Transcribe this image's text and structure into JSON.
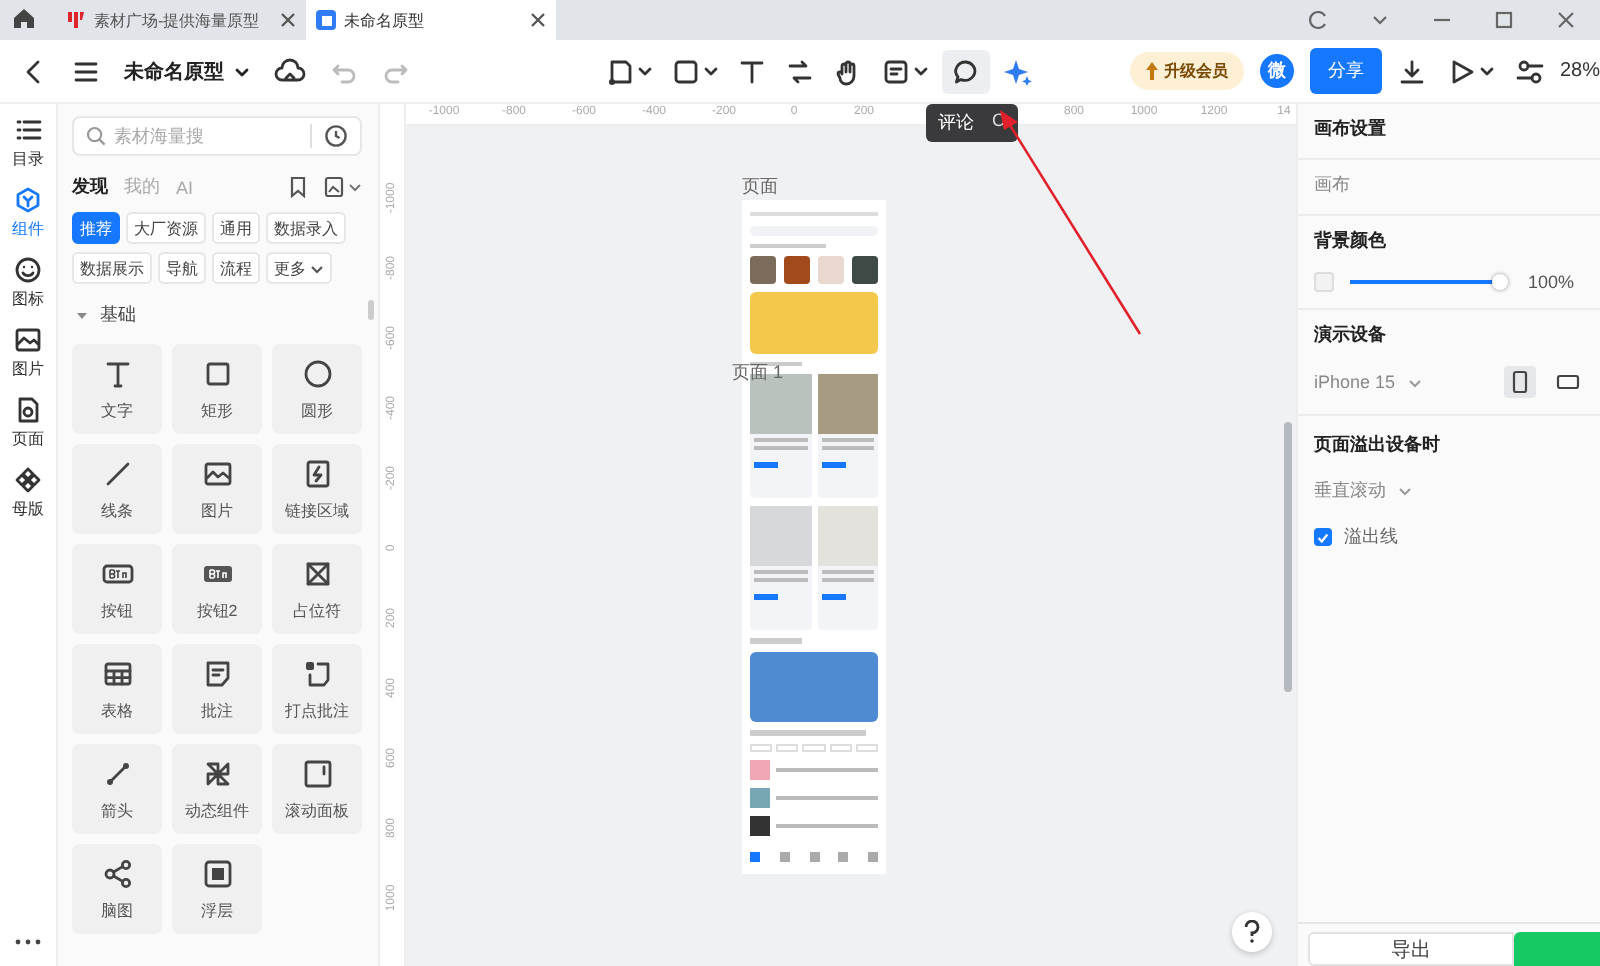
{
  "browser_tabs": [
    {
      "title": "素材广场-提供海量原型",
      "selected": false
    },
    {
      "title": "未命名原型",
      "selected": true
    }
  ],
  "toolbar": {
    "title": "未命名原型",
    "upgrade": "升级会员",
    "avatar": "微",
    "share": "分享",
    "zoom": "28%"
  },
  "tooltip": {
    "label": "评论",
    "shortcut": "C"
  },
  "rail": [
    {
      "label": "目录",
      "kind": "list",
      "selected": false
    },
    {
      "label": "组件",
      "kind": "component",
      "selected": true
    },
    {
      "label": "图标",
      "kind": "smile",
      "selected": false
    },
    {
      "label": "图片",
      "kind": "image",
      "selected": false
    },
    {
      "label": "页面",
      "kind": "page",
      "selected": false
    },
    {
      "label": "母版",
      "kind": "master",
      "selected": false
    }
  ],
  "panel": {
    "search": {
      "placeholder": "素材海量搜"
    },
    "tabs": [
      {
        "label": "发现",
        "selected": true
      },
      {
        "label": "我的",
        "selected": false
      },
      {
        "label": "AI",
        "selected": false
      }
    ],
    "chips": [
      {
        "label": "推荐",
        "selected": true
      },
      {
        "label": "大厂资源",
        "selected": false
      },
      {
        "label": "通用",
        "selected": false
      },
      {
        "label": "数据录入",
        "selected": false
      },
      {
        "label": "数据展示",
        "selected": false
      },
      {
        "label": "导航",
        "selected": false
      },
      {
        "label": "流程",
        "selected": false
      },
      {
        "label": "更多",
        "selected": false,
        "kind": "dropdown"
      }
    ],
    "section": {
      "title": "基础",
      "expanded": true
    },
    "components": [
      {
        "label": "文字",
        "kind": "text"
      },
      {
        "label": "矩形",
        "kind": "rect"
      },
      {
        "label": "圆形",
        "kind": "circle"
      },
      {
        "label": "线条",
        "kind": "line"
      },
      {
        "label": "图片",
        "kind": "image"
      },
      {
        "label": "链接区域",
        "kind": "link"
      },
      {
        "label": "按钮",
        "kind": "button"
      },
      {
        "label": "按钮2",
        "kind": "button2"
      },
      {
        "label": "占位符",
        "kind": "placeholder"
      },
      {
        "label": "表格",
        "kind": "table"
      },
      {
        "label": "批注",
        "kind": "note"
      },
      {
        "label": "打点批注",
        "kind": "pin"
      },
      {
        "label": "箭头",
        "kind": "arrow"
      },
      {
        "label": "动态组件",
        "kind": "dynamic"
      },
      {
        "label": "滚动面板",
        "kind": "scroll"
      },
      {
        "label": "脑图",
        "kind": "mindmap"
      },
      {
        "label": "浮层",
        "kind": "layer"
      }
    ]
  },
  "ruler": {
    "x_ticks": [
      "-1000",
      "-800",
      "-600",
      "-400",
      "-200",
      "0",
      "200",
      "800",
      "1000",
      "1200",
      "14"
    ],
    "y_ticks": [
      "-1000",
      "-800",
      "-600",
      "-400",
      "-200",
      "0",
      "200",
      "400",
      "600",
      "800",
      "1000"
    ]
  },
  "canvas": {
    "page_label": "页面",
    "frame_label": "页面 1"
  },
  "properties": {
    "title": "画布设置",
    "canvas_label": "画布",
    "background": {
      "title": "背景颜色",
      "level": 1,
      "reading": "100%"
    },
    "device": {
      "title": "演示设备",
      "value": "iPhone 15",
      "orientations": [
        {
          "kind": "portrait",
          "selected": true
        },
        {
          "kind": "landscape",
          "selected": false
        }
      ]
    },
    "overflow": {
      "title": "页面溢出设备时",
      "mode": "垂直滚动",
      "checkbox": {
        "label": "溢出线",
        "checked": true
      }
    },
    "export": "导出"
  }
}
